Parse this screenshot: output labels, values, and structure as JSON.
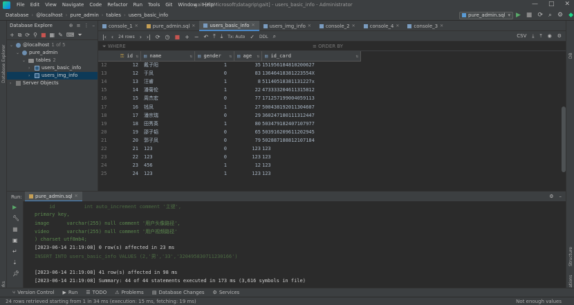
{
  "window": {
    "menu": [
      "File",
      "Edit",
      "View",
      "Navigate",
      "Code",
      "Refactor",
      "Run",
      "Tools",
      "Git",
      "Window",
      "Help"
    ],
    "title": "gait [E:\\Microsoft\\datagrip\\gait] - users_basic_info - Administrator",
    "controls": [
      "—",
      "□",
      "✕"
    ]
  },
  "navbar": {
    "breadcrumb": [
      "Database",
      "@localhost",
      "pure_admin",
      "tables",
      "users_basic_info"
    ],
    "run_config": "pure_admin.sql"
  },
  "left_strip": {
    "database_explorer": "Database Explorer",
    "bookmarks": "Bookmarks"
  },
  "right_strip": {
    "structure": "Structure",
    "notifications": "Notifications"
  },
  "explorer": {
    "title": "Database Explore",
    "tree": [
      {
        "label": "@localhost",
        "extra": "1 of 5",
        "level": 0,
        "icon": "db"
      },
      {
        "label": "pure_admin",
        "level": 1,
        "icon": "db"
      },
      {
        "label": "tables",
        "extra": "2",
        "level": 2,
        "icon": "folder"
      },
      {
        "label": "users_basic_info",
        "level": 3,
        "icon": "table"
      },
      {
        "label": "users_img_info",
        "level": 3,
        "icon": "table",
        "selected": true
      },
      {
        "label": "Server Objects",
        "level": 0,
        "icon": "server"
      }
    ]
  },
  "tabs": [
    {
      "label": "console_1",
      "icon": "console"
    },
    {
      "label": "pure_admin.sql",
      "icon": "sql"
    },
    {
      "label": "users_basic_info",
      "icon": "table",
      "active": true
    },
    {
      "label": "users_img_info",
      "icon": "table"
    },
    {
      "label": "console_2",
      "icon": "console"
    },
    {
      "label": "console_4",
      "icon": "console"
    },
    {
      "label": "console_3",
      "icon": "console"
    }
  ],
  "grid_toolbar": {
    "rows": "24 rows",
    "tx": "Tx: Auto",
    "ddl": "DDL",
    "export": "CSV"
  },
  "filter": {
    "where": "WHERE",
    "order_by": "ORDER BY"
  },
  "grid": {
    "columns": [
      "id",
      "name",
      "gender",
      "age",
      "id_card"
    ],
    "rows": [
      [
        "12",
        "12",
        "戴子阳",
        "1",
        "35",
        "151956184810200627"
      ],
      [
        "13",
        "12",
        "于凤",
        "0",
        "83",
        "13646418381223554X"
      ],
      [
        "14",
        "13",
        "汪睿",
        "1",
        "8",
        "51140518381131227x"
      ],
      [
        "15",
        "14",
        "潘菊伦",
        "1",
        "22",
        "473333204611315812"
      ],
      [
        "16",
        "15",
        "周杰宏",
        "0",
        "77",
        "171257199004059113"
      ],
      [
        "17",
        "16",
        "钱凤",
        "1",
        "27",
        "500438192011304607"
      ],
      [
        "18",
        "17",
        "潘宗瑞",
        "0",
        "29",
        "360247180111312447"
      ],
      [
        "19",
        "18",
        "田秀英",
        "1",
        "80",
        "503479182407107977"
      ],
      [
        "20",
        "19",
        "邵子韬",
        "0",
        "65",
        "503916209611202945"
      ],
      [
        "21",
        "20",
        "郭子凤",
        "0",
        "79",
        "502887188812107184"
      ],
      [
        "22",
        "21",
        "123",
        "0",
        "123",
        "123"
      ],
      [
        "23",
        "22",
        "123",
        "0",
        "123",
        "123"
      ],
      [
        "24",
        "23",
        "456",
        "1",
        "12",
        "123"
      ],
      [
        "25",
        "24",
        "123",
        "1",
        "123",
        "123"
      ]
    ]
  },
  "run": {
    "label": "Run:",
    "tab": "pure_admin.sql",
    "lines": [
      {
        "text": "     id          int auto_increment comment '主键',",
        "style": "faded"
      },
      {
        "text": "primary key,",
        "style": "green"
      },
      {
        "text": "image      varchar(255) null comment '用户头像路径',",
        "style": "green"
      },
      {
        "text": "video      varchar(255) null comment '用户视频路径'",
        "style": "green"
      },
      {
        "text": ") charset utf8mb4;",
        "style": "green"
      },
      {
        "text": "[2023-06-14 21:19:08] 0 row(s) affected in 23 ms",
        "style": "white"
      },
      {
        "text": "INSERT INTO users_basic_info VALUES (2,'男','33','320495830711230166')",
        "style": "faded"
      },
      {
        "text": "",
        "style": "white"
      },
      {
        "text": "[2023-06-14 21:19:08] 41 row(s) affected in 98 ms",
        "style": "white"
      },
      {
        "text": "[2023-06-14 21:19:08] Summary: 44 of 44 statements executed in 173 ms (3,616 symbols in file)",
        "style": "white"
      }
    ]
  },
  "bottom_tools": [
    "Version Control",
    "Run",
    "TODO",
    "Problems",
    "Database Changes",
    "Services"
  ],
  "status": {
    "left": "24 rows retrieved starting from 1 in 34 ms (execution: 15 ms, fetching: 19 ms)",
    "right": "Not enough values"
  }
}
